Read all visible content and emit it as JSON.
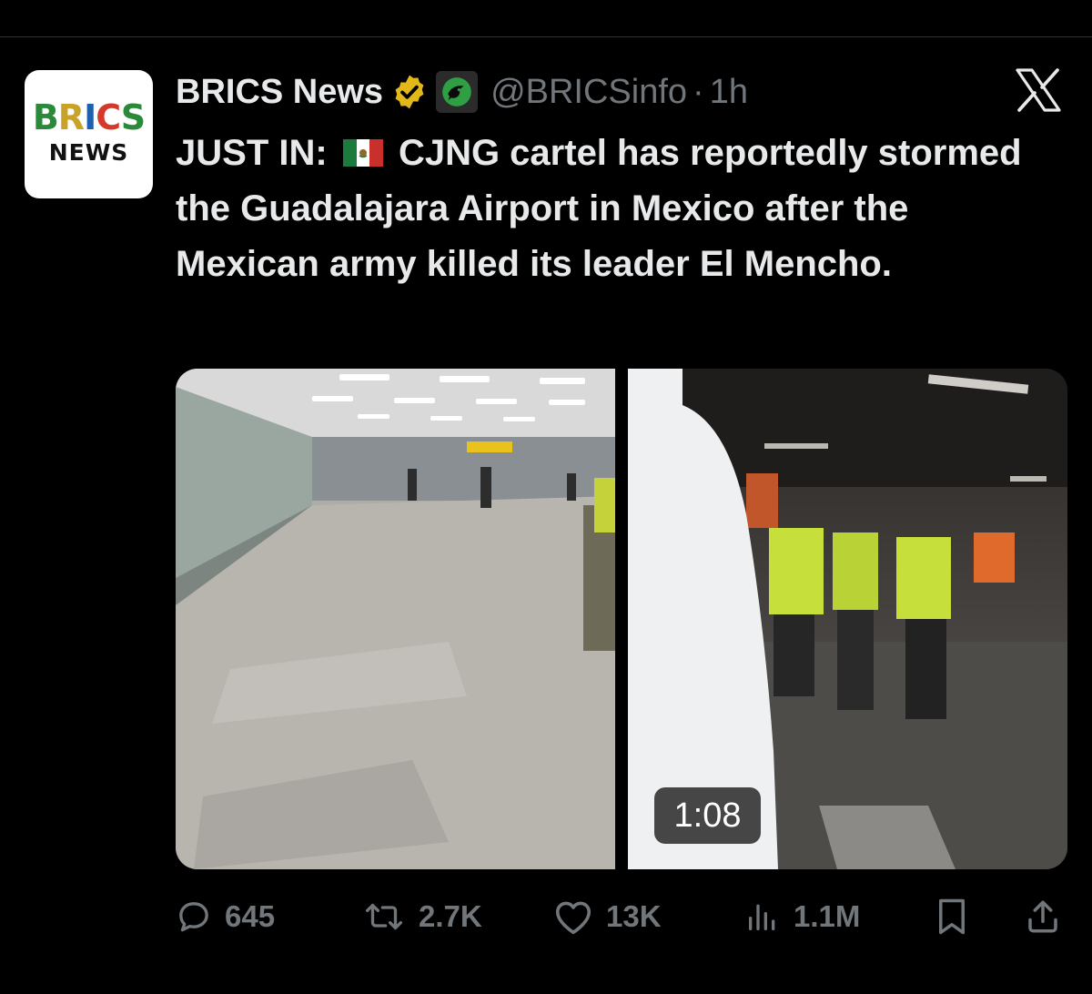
{
  "avatar": {
    "logo_letters": [
      "B",
      "R",
      "I",
      "C",
      "S"
    ],
    "logo_subtitle": "NEWS"
  },
  "author": {
    "display_name": "BRICS News",
    "handle": "@BRICSinfo",
    "separator": "·",
    "timestamp": "1h",
    "verified_icon": "gold-verified-badge-icon",
    "affiliate_icon": "affiliate-badge-icon"
  },
  "tweet": {
    "text_prefix": "JUST IN:",
    "flag_icon": "mexico-flag-icon",
    "text_body": "CJNG cartel has reportedly stormed the Guadalajara Airport in Mexico after the Mexican army killed its leader El Mencho."
  },
  "media": {
    "video_duration": "1:08"
  },
  "actions": {
    "replies": "645",
    "reposts": "2.7K",
    "likes": "13K",
    "views": "1.1M"
  },
  "colors": {
    "background": "#000000",
    "text_primary": "#e7e9ea",
    "text_secondary": "#71767b",
    "verified_gold": "#e2b719"
  }
}
